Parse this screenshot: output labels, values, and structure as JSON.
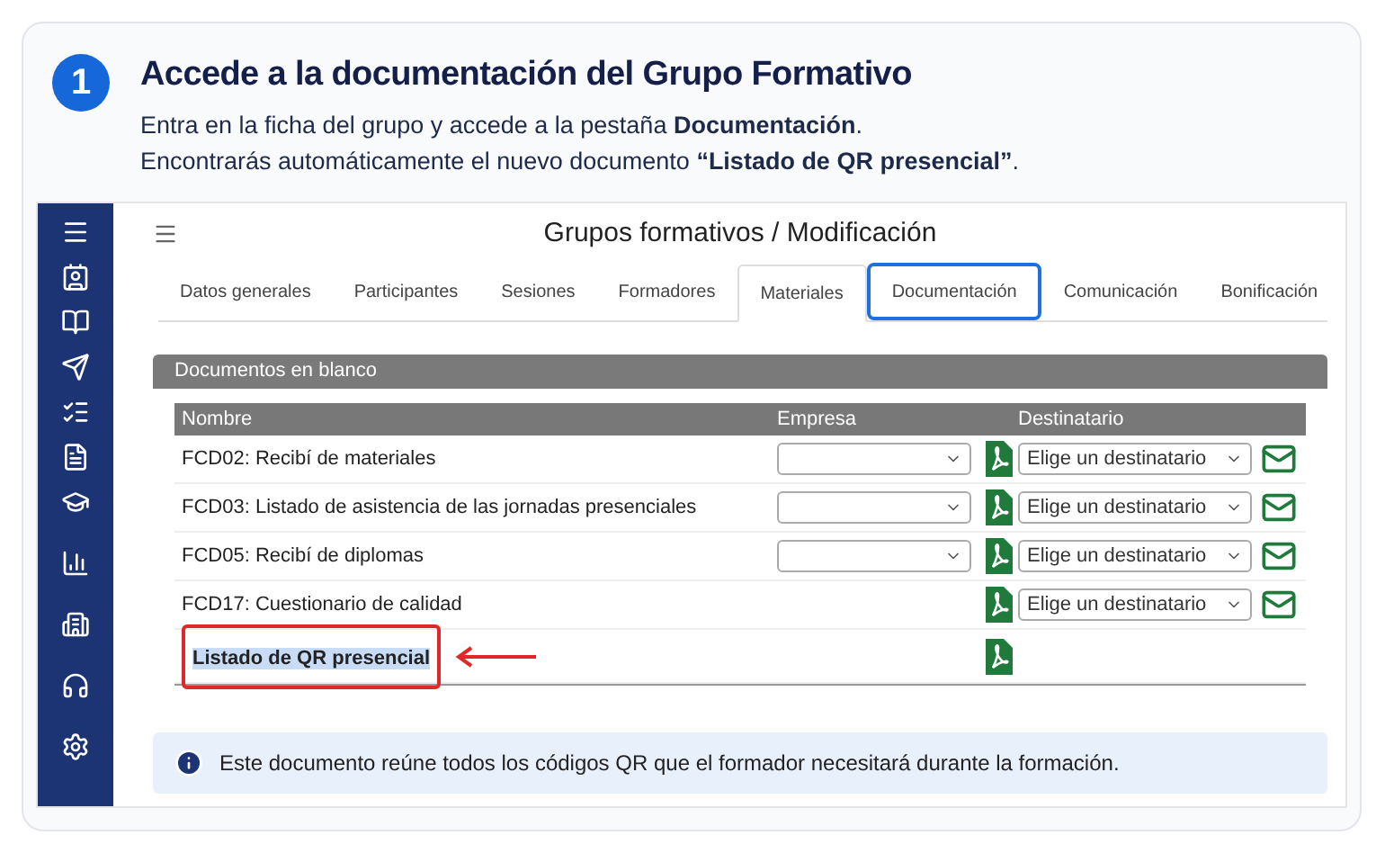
{
  "step": {
    "number": "1",
    "title": "Accede a la documentación del Grupo Formativo",
    "lines": [
      "Entra en la ficha del grupo y accede a la pestaña **Documentación**.",
      "Encontrarás automáticamente el nuevo documento **“Listado de QR presencial”**."
    ]
  },
  "app": {
    "title": "Grupos formativos / Modificación",
    "tabs": [
      {
        "label": "Datos generales",
        "selected": false,
        "outlined": false
      },
      {
        "label": "Participantes",
        "selected": false,
        "outlined": false
      },
      {
        "label": "Sesiones",
        "selected": false,
        "outlined": false
      },
      {
        "label": "Formadores",
        "selected": false,
        "outlined": false
      },
      {
        "label": "Materiales",
        "selected": false,
        "outlined": true
      },
      {
        "label": "Documentación",
        "selected": true,
        "outlined": false
      },
      {
        "label": "Comunicación",
        "selected": false,
        "outlined": false
      },
      {
        "label": "Bonificación",
        "selected": false,
        "outlined": false
      }
    ],
    "panel": {
      "title": "Documentos en blanco",
      "columns": [
        "Nombre",
        "Empresa",
        "Destinatario"
      ],
      "rows": [
        {
          "name": "FCD02: Recibí de materiales",
          "empresa_select": true,
          "destinatario": "Elige un destinatario",
          "highlighted": false
        },
        {
          "name": "FCD03: Listado de asistencia de las jornadas presenciales",
          "empresa_select": true,
          "destinatario": "Elige un destinatario",
          "highlighted": false
        },
        {
          "name": "FCD05: Recibí de diplomas",
          "empresa_select": true,
          "destinatario": "Elige un destinatario",
          "highlighted": false
        },
        {
          "name": "FCD17: Cuestionario de calidad",
          "empresa_select": false,
          "destinatario": "Elige un destinatario",
          "highlighted": false
        },
        {
          "name": "Listado de QR presencial",
          "empresa_select": false,
          "highlighted": true
        }
      ]
    }
  },
  "info": "Este documento reúne todos los códigos QR que el formador necesitará durante la formación."
}
